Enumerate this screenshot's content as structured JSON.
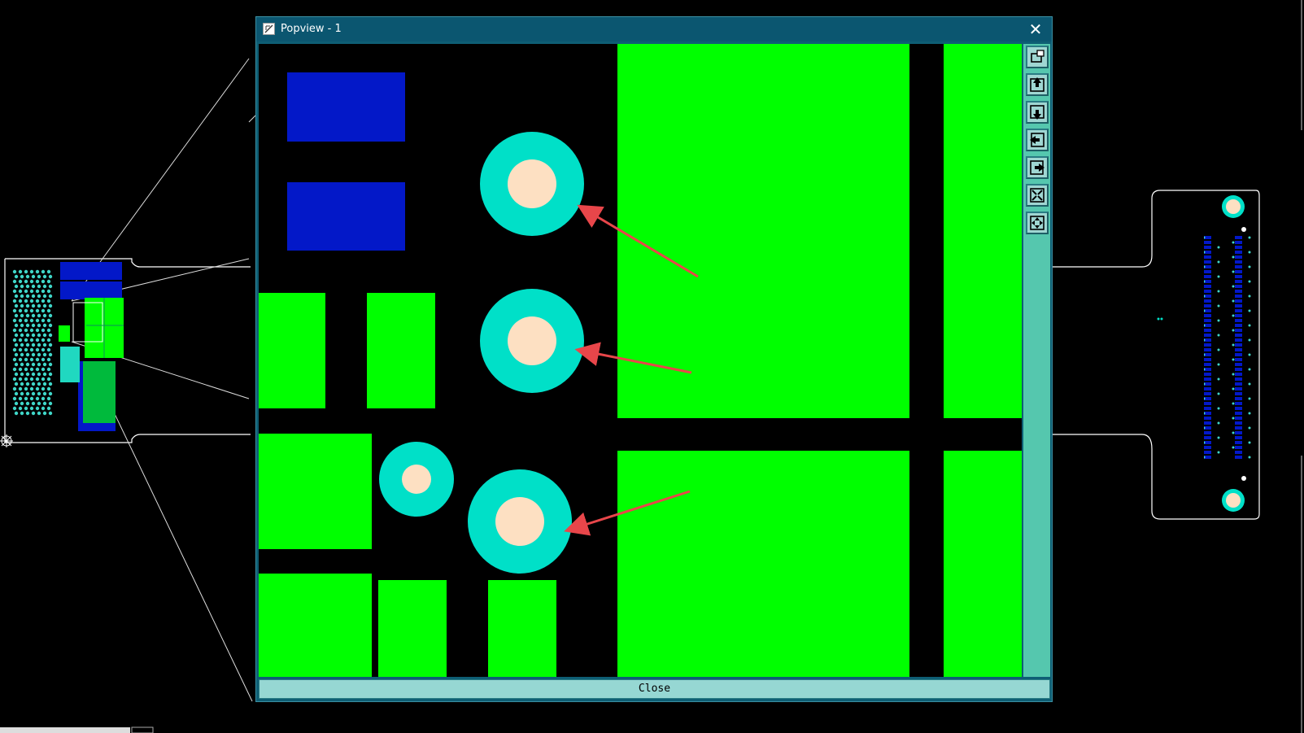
{
  "window": {
    "title": "Popview - 1",
    "close_glyph": "✕",
    "close_button_label": "Close"
  },
  "toolbar": {
    "buttons": [
      {
        "icon": "zoom-window-icon"
      },
      {
        "icon": "pan-up-icon"
      },
      {
        "icon": "pan-down-icon"
      },
      {
        "icon": "pan-left-icon"
      },
      {
        "icon": "pan-right-icon"
      },
      {
        "icon": "zoom-fit-icon"
      },
      {
        "icon": "zoom-center-icon"
      }
    ]
  },
  "colors": {
    "background": "#000000",
    "copper_fill": "#00ff00",
    "smd_pad": "#0318c8",
    "via_ring": "#00e0c8",
    "via_drill": "#fde0c2",
    "annotation_arrow": "#e8464a",
    "outline": "#ffffff",
    "window_frame": "#0b5670",
    "toolbar_bg": "#55c7ae"
  }
}
